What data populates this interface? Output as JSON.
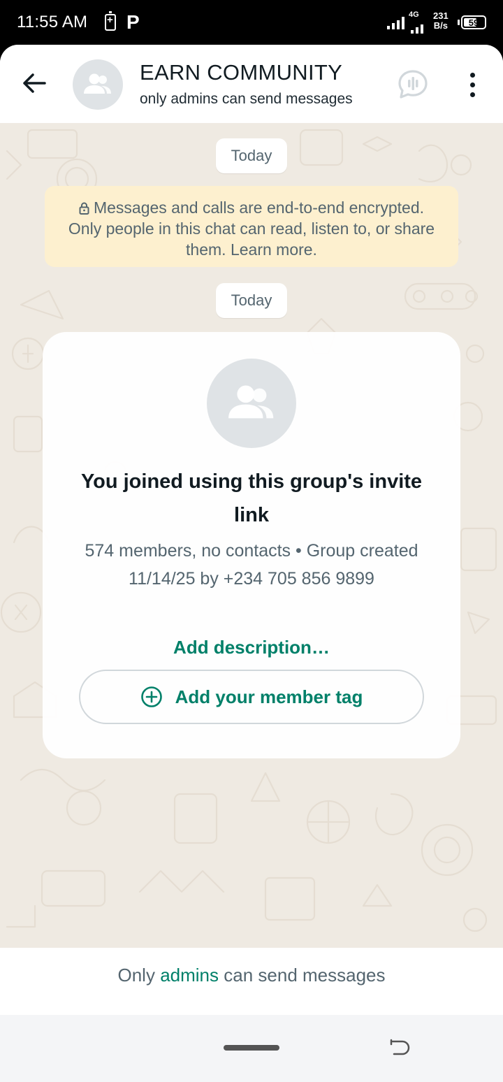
{
  "status_bar": {
    "time": "11:55 AM",
    "p_glyph": "P",
    "network": "4G",
    "speed_value": "231",
    "speed_unit": "B/s",
    "battery": "59"
  },
  "header": {
    "title": "EARN COMMUNITY",
    "subtitle": "only admins can send messages",
    "back_icon": "arrow-left-icon",
    "avatar_icon": "group-icon",
    "call_icon": "call-add-icon",
    "menu_icon": "more-vert-icon"
  },
  "chat": {
    "date_chip_1": "Today",
    "encryption_notice": "Messages and calls are end-to-end encrypted. Only people in this chat can read, listen to, or share them. Learn more.",
    "date_chip_2": "Today",
    "group_card": {
      "title": "You joined using this group's invite link",
      "info": "574 members, no contacts • Group created 11/14/25 by +234 705 856 9899",
      "add_description": "Add description…",
      "member_tag_button": "Add your member tag"
    }
  },
  "footer": {
    "prefix": "Only",
    "link": "admins",
    "suffix": "can send messages"
  },
  "colors": {
    "accent": "#008069",
    "chat_background": "#efeae2",
    "notice_background": "#fdf0cf"
  }
}
